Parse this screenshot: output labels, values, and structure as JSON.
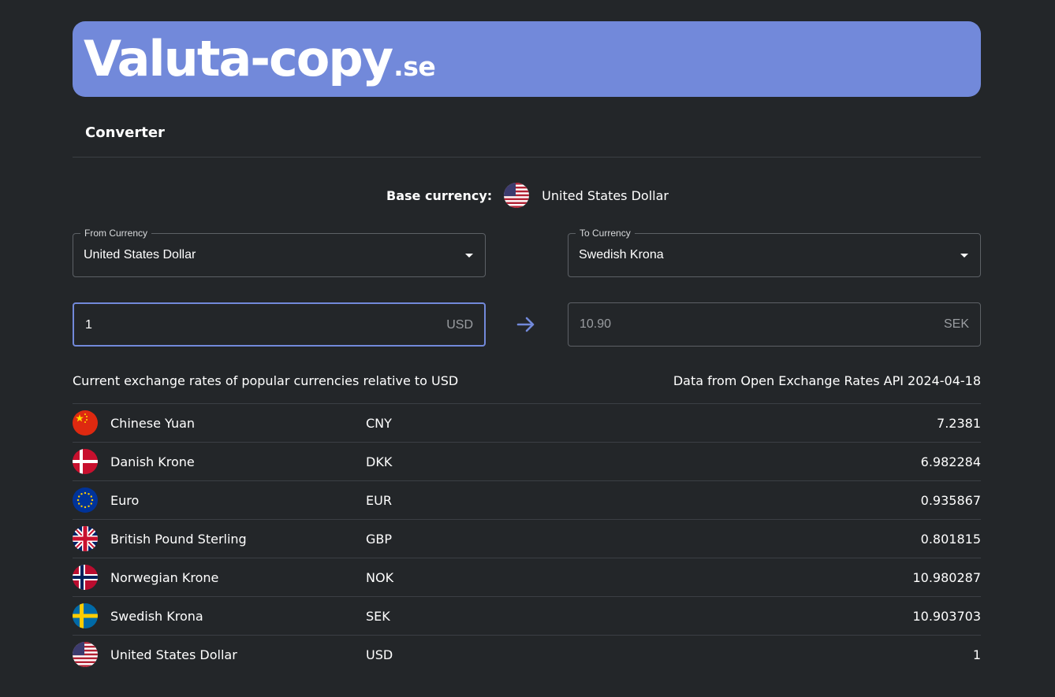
{
  "header": {
    "logo_main": "Valuta-copy",
    "logo_tld": ".se",
    "brand_color": "#7289da"
  },
  "nav": {
    "tab_label": "Converter"
  },
  "base": {
    "label": "Base currency:",
    "currency": "United States Dollar",
    "flag_icon": "us-flag-icon"
  },
  "converter": {
    "from": {
      "legend": "From Currency",
      "value": "United States Dollar"
    },
    "to": {
      "legend": "To Currency",
      "value": "Swedish Krona"
    },
    "amount": {
      "value": "1",
      "unit": "USD"
    },
    "result": {
      "value": "10.90",
      "unit": "SEK"
    },
    "arrow_icon": "arrow-right-icon"
  },
  "info": {
    "left": "Current exchange rates of popular currencies relative to USD",
    "right": "Data from Open Exchange Rates API 2024-04-18"
  },
  "rates": [
    {
      "name": "Chinese Yuan",
      "code": "CNY",
      "rate": "7.2381",
      "flag_icon": "china-flag-icon"
    },
    {
      "name": "Danish Krone",
      "code": "DKK",
      "rate": "6.982284",
      "flag_icon": "denmark-flag-icon"
    },
    {
      "name": "Euro",
      "code": "EUR",
      "rate": "0.935867",
      "flag_icon": "eu-flag-icon"
    },
    {
      "name": "British Pound Sterling",
      "code": "GBP",
      "rate": "0.801815",
      "flag_icon": "uk-flag-icon"
    },
    {
      "name": "Norwegian Krone",
      "code": "NOK",
      "rate": "10.980287",
      "flag_icon": "norway-flag-icon"
    },
    {
      "name": "Swedish Krona",
      "code": "SEK",
      "rate": "10.903703",
      "flag_icon": "sweden-flag-icon"
    },
    {
      "name": "United States Dollar",
      "code": "USD",
      "rate": "1",
      "flag_icon": "us-flag-icon"
    }
  ]
}
